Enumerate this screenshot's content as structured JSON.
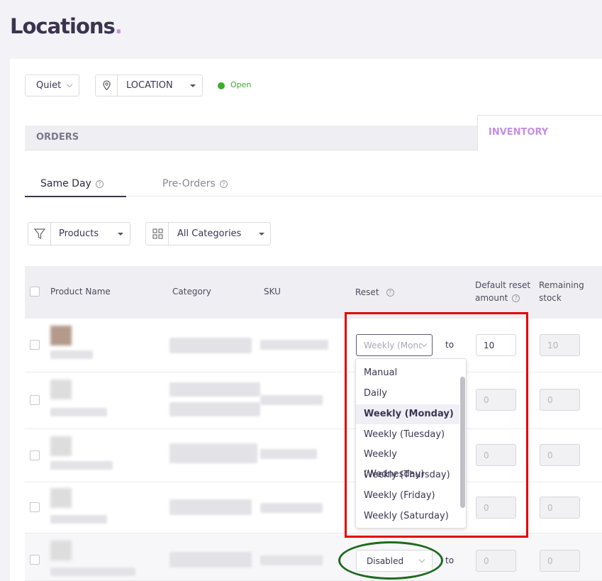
{
  "page": {
    "title": "Locations",
    "title_dot": "."
  },
  "filters": {
    "mode_value": "Quiet",
    "location_value": "LOCATION",
    "status_text": "Open"
  },
  "tabs": {
    "orders": "ORDERS",
    "inventory": "INVENTORY"
  },
  "subtabs": {
    "same_day": "Same Day",
    "pre_orders": "Pre-Orders"
  },
  "toolbar": {
    "products_label": "Products",
    "categories_label": "All Categories"
  },
  "table": {
    "headers": {
      "product_name": "Product Name",
      "category": "Category",
      "sku": "SKU",
      "reset": "Reset",
      "default_reset_amount": "Default reset amount",
      "remaining_stock": "Remaining stock"
    },
    "rows": [
      {
        "reset_value": "Weekly (Monday)",
        "to": "to",
        "default_amount": "10",
        "remaining": "10"
      },
      {
        "default_amount": "0",
        "remaining": "0"
      },
      {
        "default_amount": "0",
        "remaining": "0"
      },
      {
        "default_amount": "0",
        "remaining": "0"
      },
      {
        "reset_value": "Disabled",
        "to": "to",
        "default_amount": "0",
        "remaining": "0"
      }
    ]
  },
  "dropdown": {
    "options": [
      "Manual",
      "Daily",
      "Weekly (Monday)",
      "Weekly (Tuesday)",
      "Weekly (Wednesday)",
      "Weekly (Thursday)",
      "Weekly (Friday)",
      "Weekly (Saturday)"
    ],
    "selected": "Weekly (Monday)"
  },
  "colors": {
    "accent": "#c58ee3",
    "status_green": "#3dae2b",
    "annotation_red": "#e30000",
    "annotation_green": "#1e6b1e"
  },
  "icons": {
    "location": "map-pin-icon",
    "filter": "filter-icon",
    "categories": "grid-icon",
    "help": "question-circle-icon"
  }
}
